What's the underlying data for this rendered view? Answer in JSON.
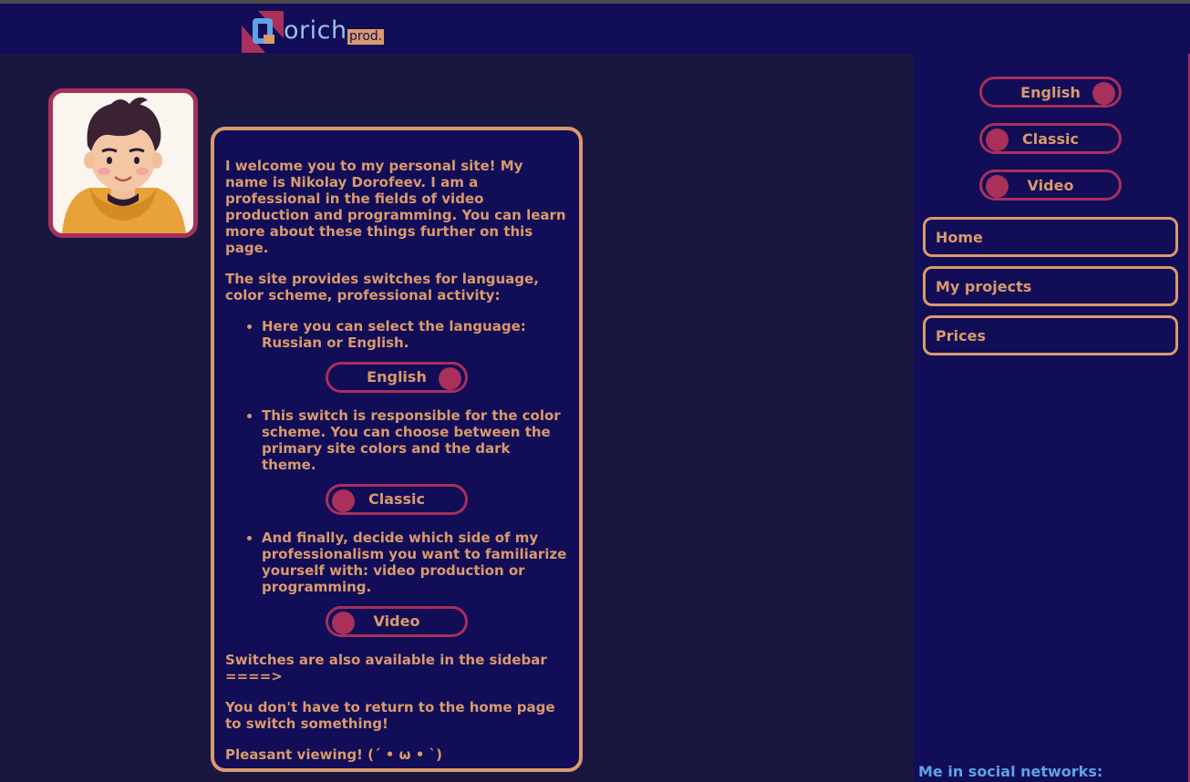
{
  "header": {
    "logo_letter": "D",
    "logo_word": "orich",
    "logo_suffix": "prod."
  },
  "content": {
    "intro": "I welcome you to my personal site! My name is Nikolay Dorofeev. I am a professional in the fields of video production and programming. You can learn more about these things further on this page.",
    "switches_intro": "The site provides switches for language, color scheme, professional activity:",
    "items": [
      {
        "text": "Here you can select the language: Russian or English.",
        "switch_label": "English"
      },
      {
        "text": "This switch is responsible for the color scheme. You can choose between the primary site colors and the dark theme.",
        "switch_label": "Classic"
      },
      {
        "text": "And finally, decide which side of my professionalism you want to familiarize yourself with: video production or programming.",
        "switch_label": "Video"
      }
    ],
    "sidebar_note": "Switches are also available in the sidebar ====>",
    "no_return_note": "You don't have to return to the home page to switch something!",
    "farewell": "Pleasant viewing! (´ • ω • `)"
  },
  "sidebar": {
    "switches": [
      {
        "label": "English",
        "knob": "right"
      },
      {
        "label": "Classic",
        "knob": "left"
      },
      {
        "label": "Video",
        "knob": "left"
      }
    ],
    "nav": [
      {
        "label": "Home"
      },
      {
        "label": "My projects"
      },
      {
        "label": "Prices"
      }
    ],
    "social_label": "Me in social networks:"
  },
  "colors": {
    "background": "#191740",
    "panel": "#120d57",
    "accent": "#d99a6c",
    "switch_border": "#a8305a",
    "link": "#5ea3e6"
  }
}
